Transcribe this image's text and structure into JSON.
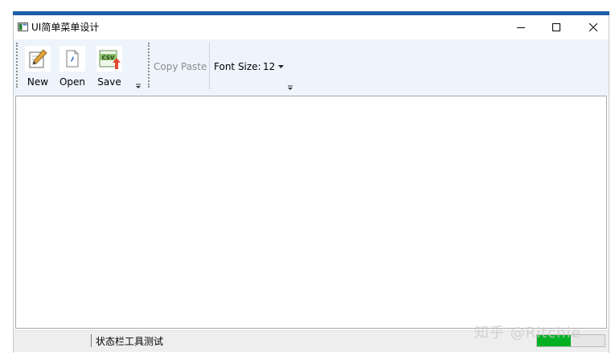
{
  "window": {
    "title": "UI简单菜单设计",
    "accent_color": "#1f5fa8"
  },
  "window_controls": [
    "minimize",
    "maximize",
    "close"
  ],
  "toolbar": {
    "file_buttons": [
      {
        "label": "New",
        "icon": "pencil-paper-icon"
      },
      {
        "label": "Open",
        "icon": "document-icon"
      },
      {
        "label": "Save",
        "icon": "csv-export-icon"
      }
    ],
    "icon_text": "CSV",
    "copy_label": "Copy",
    "paste_label": "Paste",
    "font_size_label": "Font Size:",
    "font_size_value": "12"
  },
  "editor": {
    "content": ""
  },
  "statusbar": {
    "text": "状态栏工具测试",
    "progress": 0.5,
    "progress_color": "#06b025"
  },
  "watermark": "知乎 @Ritchie"
}
